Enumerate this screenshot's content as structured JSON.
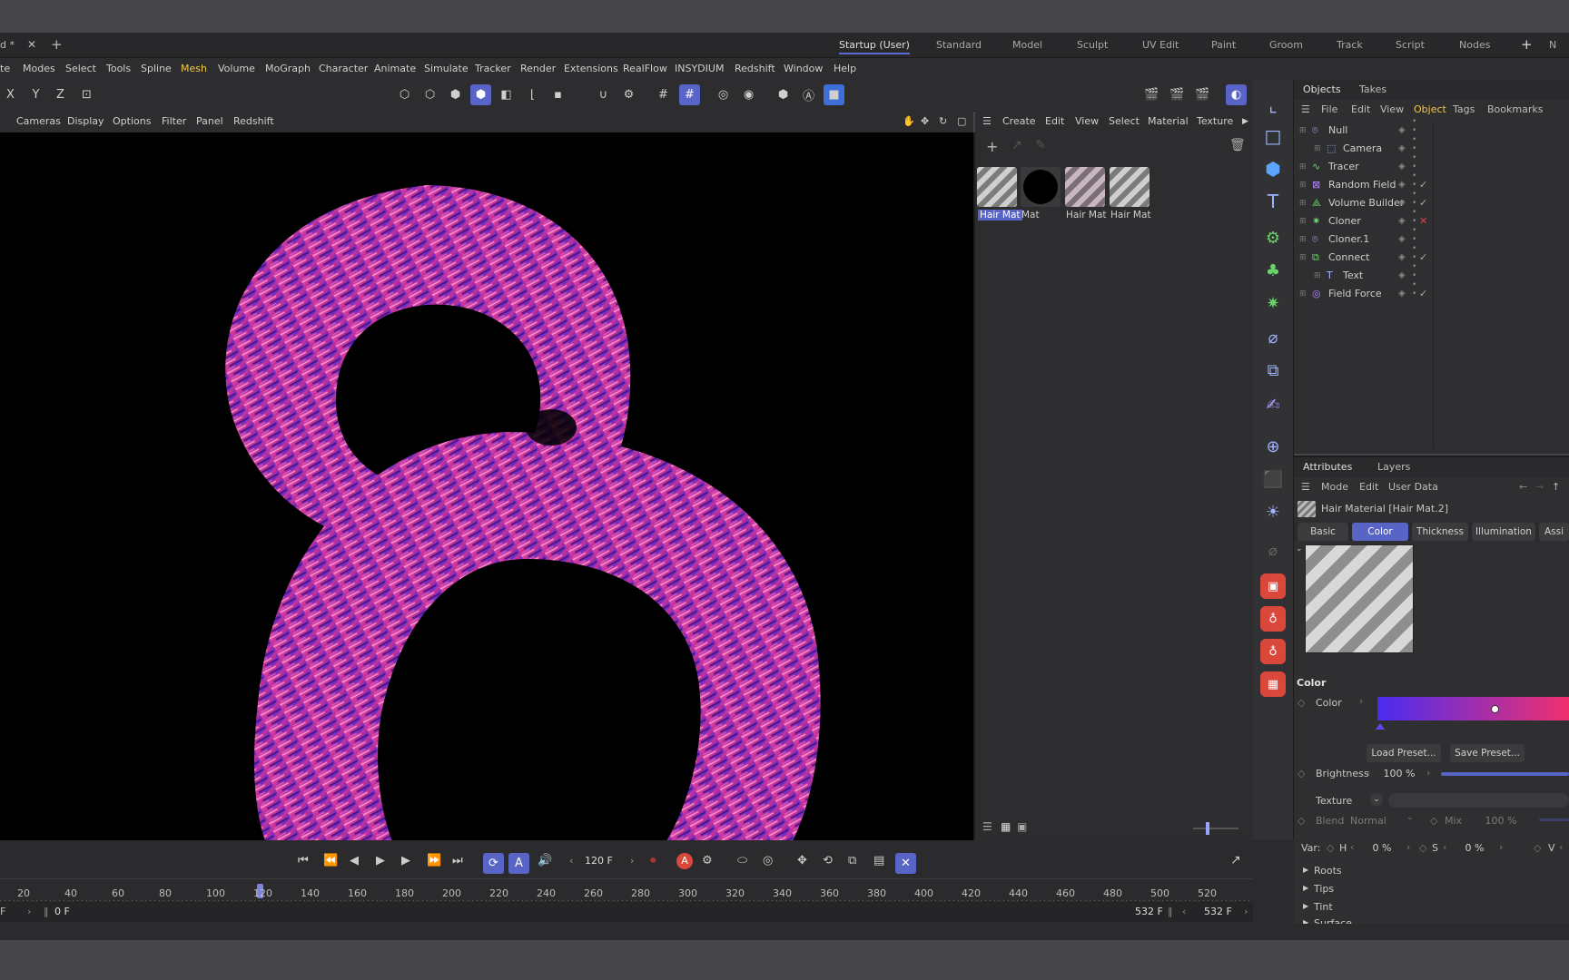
{
  "document_tab": "d *",
  "tabs_row": {
    "layouts": [
      "Startup (User)",
      "Standard",
      "Model",
      "Sculpt",
      "UV Edit",
      "Paint",
      "Groom",
      "Track",
      "Script",
      "Nodes"
    ],
    "active_layout": "Startup (User)",
    "overflow": "N"
  },
  "main_menu": [
    "te",
    "Modes",
    "Select",
    "Tools",
    "Spline",
    "Mesh",
    "Volume",
    "MoGraph",
    "Character",
    "Animate",
    "Simulate",
    "Tracker",
    "Render",
    "Extensions",
    "RealFlow",
    "INSYDIUM",
    "Redshift",
    "Window",
    "Help"
  ],
  "axis_buttons": [
    "X",
    "Y",
    "Z"
  ],
  "viewport_menu": [
    "Cameras",
    "Display",
    "Options",
    "Filter",
    "Panel",
    "Redshift"
  ],
  "material_menu": [
    "Create",
    "Edit",
    "View",
    "Select",
    "Material",
    "Texture"
  ],
  "materials": [
    {
      "label": "Hair Mat",
      "kind": "hair",
      "selected": true
    },
    {
      "label": "Mat",
      "kind": "black",
      "selected": false
    },
    {
      "label": "Hair Mat",
      "kind": "hair-pink",
      "selected": false
    },
    {
      "label": "Hair Mat",
      "kind": "hair",
      "selected": false
    }
  ],
  "objects_panel": {
    "tabs": [
      "Objects",
      "Takes"
    ],
    "menu": [
      "File",
      "Edit",
      "View",
      "Object",
      "Tags",
      "Bookmarks"
    ],
    "items": [
      {
        "name": "Null",
        "indent": 0,
        "icon": "null-icon"
      },
      {
        "name": "Camera",
        "indent": 1,
        "icon": "camera-icon"
      },
      {
        "name": "Tracer",
        "indent": 0,
        "icon": "tracer-icon"
      },
      {
        "name": "Random Field",
        "indent": 0,
        "icon": "random-field-icon"
      },
      {
        "name": "Volume Builder",
        "indent": 0,
        "icon": "volume-builder-icon"
      },
      {
        "name": "Cloner",
        "indent": 0,
        "icon": "cloner-icon"
      },
      {
        "name": "Cloner.1",
        "indent": 0,
        "icon": "null-icon"
      },
      {
        "name": "Connect",
        "indent": 0,
        "icon": "connect-icon"
      },
      {
        "name": "Text",
        "indent": 1,
        "icon": "text-spline-icon"
      },
      {
        "name": "Field Force",
        "indent": 0,
        "icon": "field-force-icon"
      }
    ]
  },
  "attributes_panel": {
    "tabs": [
      "Attributes",
      "Layers"
    ],
    "menu": [
      "Mode",
      "Edit",
      "User Data"
    ],
    "title": "Hair Material [Hair Mat.2]",
    "subtabs": [
      "Basic",
      "Color",
      "Thickness",
      "Illumination",
      "Assi"
    ],
    "active_subtab": "Color",
    "section": "Color",
    "color_label": "Color",
    "load_preset": "Load Preset...",
    "save_preset": "Save Preset...",
    "brightness_label": "Brightness",
    "brightness_value": "100 %",
    "texture_label": "Texture",
    "blend_label": "Blend",
    "blend_value": "Normal",
    "mix_label": "Mix",
    "mix_value": "100 %",
    "var_label": "Var:",
    "h_label": "H",
    "h_value": "0 %",
    "s_label": "S",
    "s_value": "0 %",
    "v_label": "V",
    "groups": [
      "Roots",
      "Tips",
      "Tint",
      "Surface"
    ],
    "gradient_start": "#4a2cf0",
    "gradient_end": "#f0306e"
  },
  "timeline": {
    "current_frame": "120 F",
    "ticks": [
      "20",
      "40",
      "60",
      "80",
      "100",
      "120",
      "140",
      "160",
      "180",
      "200",
      "220",
      "240",
      "260",
      "280",
      "300",
      "320",
      "340",
      "360",
      "380",
      "400",
      "420",
      "440",
      "460",
      "480",
      "500",
      "520"
    ],
    "start_field": "0 F",
    "end_label": "532 F",
    "end_field": "532 F",
    "left_field": "F"
  },
  "colors": {
    "accent": "#5864c6",
    "hair_pink": "#e63aa0",
    "hair_purple": "#6a2cc8",
    "selected_item": "#f2c94c"
  }
}
